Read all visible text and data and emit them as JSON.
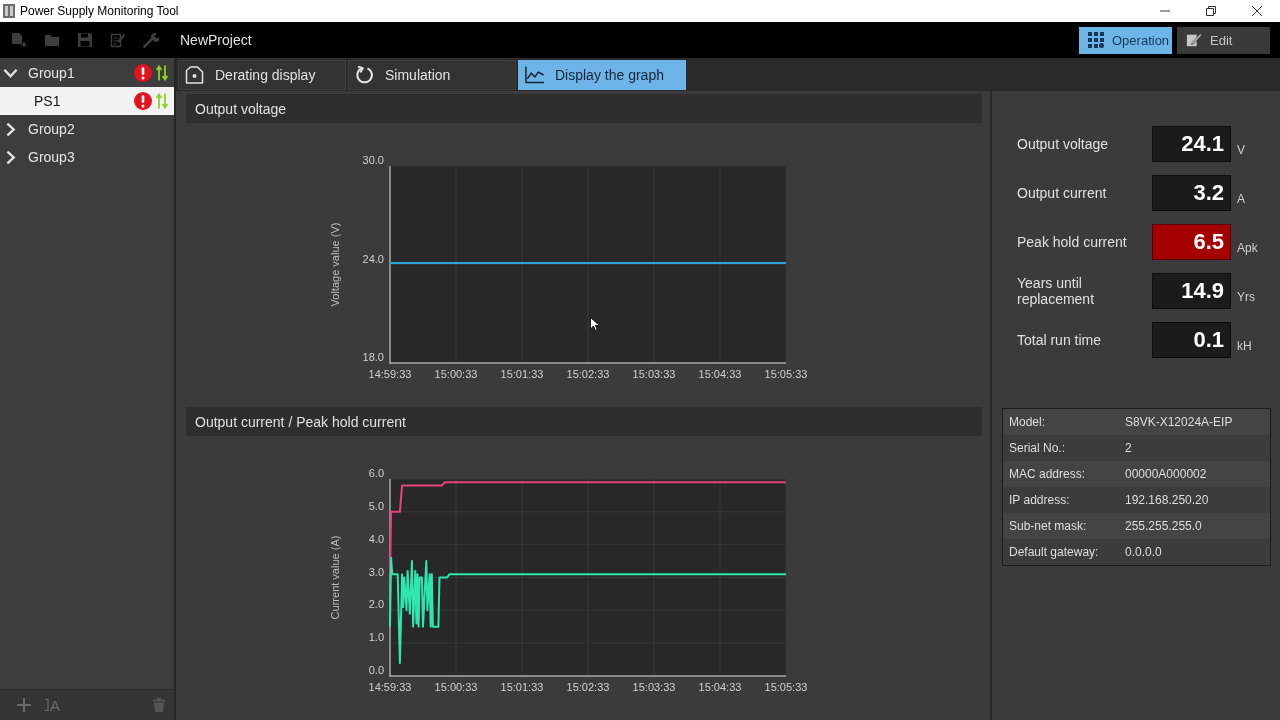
{
  "window": {
    "title": "Power Supply Monitoring Tool"
  },
  "toolbar": {
    "buttons": [
      {
        "kind": "new",
        "disabled": true
      },
      {
        "kind": "open",
        "disabled": true
      },
      {
        "kind": "save",
        "disabled": true
      },
      {
        "kind": "edit",
        "disabled": true
      },
      {
        "kind": "settings",
        "disabled": true
      }
    ],
    "project": "NewProject",
    "modes": [
      {
        "kind": "operation",
        "label": "Operation",
        "selected": true
      },
      {
        "kind": "edit",
        "label": "Edit",
        "selected": false
      }
    ]
  },
  "sidebar": {
    "tree": [
      {
        "label": "Group1",
        "expanded": true,
        "selected": false,
        "alert": true,
        "communicating": true,
        "children": [
          {
            "label": "PS1",
            "selected": true,
            "alert": true,
            "communicating": true
          }
        ]
      },
      {
        "label": "Group2",
        "expanded": false,
        "selected": false,
        "alert": false,
        "communicating": false
      },
      {
        "label": "Group3",
        "expanded": false,
        "selected": false,
        "alert": false,
        "communicating": false
      }
    ],
    "footer": [
      {
        "kind": "add"
      },
      {
        "kind": "rename",
        "text": "A"
      },
      {
        "kind": "delete"
      }
    ]
  },
  "tabs": [
    {
      "kind": "derating",
      "label": "Derating display",
      "selected": false
    },
    {
      "kind": "simulation",
      "label": "Simulation",
      "selected": false
    },
    {
      "kind": "graph",
      "label": "Display the graph",
      "selected": true
    }
  ],
  "graphs": [
    {
      "heading": "Output voltage",
      "chart_data": [
        {
          "type": "line",
          "ylabel": "Voltage value (V)",
          "x": [
            14.9925,
            15.0925
          ],
          "xlim": [
            14.9925,
            15.0925
          ],
          "ylim": [
            18,
            30
          ],
          "xticks": [
            {
              "value": 14.9925,
              "label": "14:59:33"
            },
            {
              "value": 15.00917,
              "label": "15:00:33"
            },
            {
              "value": 15.02583,
              "label": "15:01:33"
            },
            {
              "value": 15.0425,
              "label": "15:02:33"
            },
            {
              "value": 15.05917,
              "label": "15:03:33"
            },
            {
              "value": 15.07583,
              "label": "15:04:33"
            },
            {
              "value": 15.0925,
              "label": "15:05:33"
            }
          ],
          "yticks": [
            {
              "value": 18,
              "label": "18.0"
            },
            {
              "value": 24,
              "label": "24.0"
            },
            {
              "value": 30,
              "label": "30.0"
            }
          ],
          "grid": true,
          "series": [
            {
              "color": "#2aa6dc",
              "values": [
                24.1,
                24.1
              ]
            }
          ]
        }
      ]
    },
    {
      "heading": "Output current / Peak hold current",
      "chart_data": [
        {
          "type": "line",
          "ylabel": "Current value (A)",
          "xlim": [
            14.9925,
            15.0925
          ],
          "ylim": [
            0,
            6
          ],
          "xticks": [
            {
              "value": 14.9925,
              "label": "14:59:33"
            },
            {
              "value": 15.00917,
              "label": "15:00:33"
            },
            {
              "value": 15.02583,
              "label": "15:01:33"
            },
            {
              "value": 15.0425,
              "label": "15:02:33"
            },
            {
              "value": 15.05917,
              "label": "15:03:33"
            },
            {
              "value": 15.07583,
              "label": "15:04:33"
            },
            {
              "value": 15.0925,
              "label": "15:05:33"
            }
          ],
          "yticks": [
            {
              "value": 0,
              "label": "0.0"
            },
            {
              "value": 1,
              "label": "1.0"
            },
            {
              "value": 2,
              "label": "2.0"
            },
            {
              "value": 3,
              "label": "3.0"
            },
            {
              "value": 4,
              "label": "4.0"
            },
            {
              "value": 5,
              "label": "5.0"
            },
            {
              "value": 6,
              "label": "6.0"
            }
          ],
          "grid": true,
          "series": [
            {
              "color": "#e8407e",
              "x": [
                14.9925,
                14.99278,
                14.995,
                14.99556,
                15.00556,
                15.00639,
                15.0925
              ],
              "values": [
                3.1,
                5.0,
                5.0,
                5.8,
                5.8,
                5.9,
                5.9
              ]
            },
            {
              "color": "#2ee6ae",
              "x": [
                14.9925,
                14.99278,
                14.99306,
                14.99444,
                14.995,
                14.99556,
                14.99583,
                14.99611,
                14.99667,
                14.99694,
                14.9975,
                14.99806,
                14.99833,
                14.99889,
                14.99917,
                14.99944,
                14.99972,
                15.0,
                15.00056,
                15.00083,
                15.00167,
                15.00194,
                15.0025,
                15.00278,
                15.00306,
                15.00333,
                15.00472,
                15.005,
                15.00694,
                15.0075,
                15.0925
              ],
              "values": [
                1.5,
                3.6,
                3.1,
                3.1,
                0.4,
                3.1,
                2.1,
                3.0,
                2.0,
                3.2,
                1.9,
                3.5,
                1.5,
                3.2,
                1.6,
                3.1,
                1.5,
                3.0,
                3.0,
                1.5,
                3.5,
                2.0,
                3.1,
                1.5,
                3.1,
                1.5,
                1.5,
                3.0,
                3.0,
                3.1,
                3.1
              ]
            }
          ]
        }
      ]
    }
  ],
  "readings": [
    {
      "label": "Output voltage",
      "value": "24.1",
      "unit": "V",
      "alarm": false
    },
    {
      "label": "Output current",
      "value": "3.2",
      "unit": "A",
      "alarm": false
    },
    {
      "label": "Peak hold current",
      "value": "6.5",
      "unit": "Apk",
      "alarm": true
    },
    {
      "label": "Years until replacement",
      "value": "14.9",
      "unit": "Yrs",
      "alarm": false
    },
    {
      "label": "Total run time",
      "value": "0.1",
      "unit": "kH",
      "alarm": false
    }
  ],
  "device_info": [
    {
      "label": "Model:",
      "value": "S8VK-X12024A-EIP"
    },
    {
      "label": "Serial No.:",
      "value": "2"
    },
    {
      "label": "MAC address:",
      "value": "00000A000002"
    },
    {
      "label": "IP address:",
      "value": "192.168.250.20"
    },
    {
      "label": "Sub-net mask:",
      "value": "255.255.255.0"
    },
    {
      "label": "Default gateway:",
      "value": "0.0.0.0"
    }
  ]
}
